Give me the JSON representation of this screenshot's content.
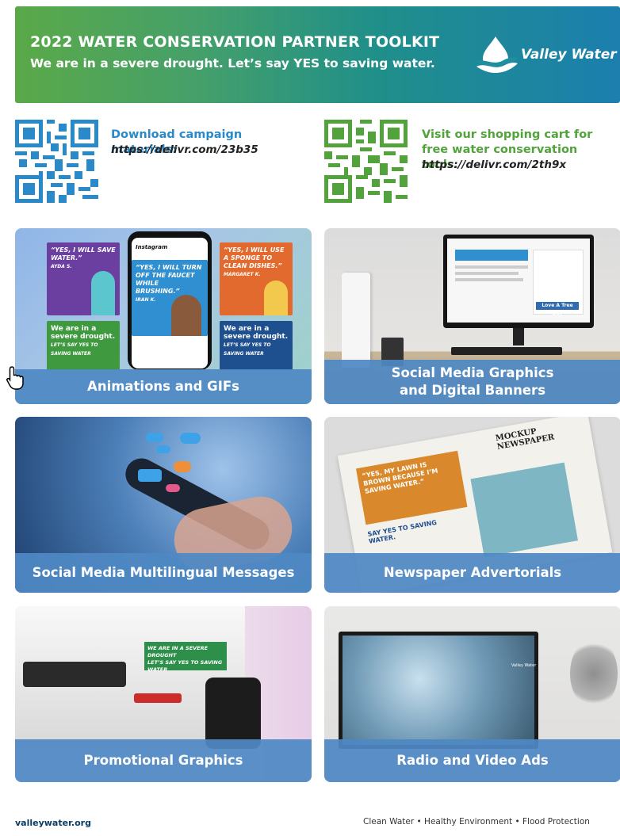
{
  "header": {
    "title": "2022 WATER CONSERVATION PARTNER TOOLKIT",
    "subtitle": "We are in a severe drought. Let’s say YES to saving water.",
    "logo_text": "Valley Water"
  },
  "qr_sections": [
    {
      "label": "Download campaign materials:",
      "url": "https://delivr.com/23b35",
      "color": "#2a89c8"
    },
    {
      "label": "Visit our shopping cart for free water conservation tools.",
      "url": "https://delivr.com/2th9x",
      "color": "#53a33c"
    }
  ],
  "cards": {
    "animations": {
      "caption": "Animations and GIFs",
      "poster1": "“YES, I WILL SAVE WATER.”",
      "poster1_name": "AYDA S.",
      "poster2": "“YES, I WILL TURN OFF THE FAUCET WHILE BRUSHING.”",
      "poster2_name": "IRAN K.",
      "poster3": "“YES, I WILL USE A SPONGE TO CLEAN DISHES.”",
      "poster3_name": "MARGARET K.",
      "poster4": "We are in a severe drought.",
      "poster4_cta": "LET’S SAY YES TO SAVING WATER",
      "poster5": "We are in a severe drought.",
      "poster5_cta": "LET’S SAY YES TO SAVING WATER",
      "phone_app": "Instagram"
    },
    "social_graphics": {
      "caption_line1": "Social Media Graphics",
      "caption_line2": "and Digital Banners",
      "screen_banner": "Love A Tree Day"
    },
    "multilingual": {
      "caption": "Social Media Multilingual Messages"
    },
    "newspaper": {
      "caption": "Newspaper Advertorials",
      "ad_headline": "“YES, MY LAWN IS BROWN BECAUSE I’M SAVING WATER.”",
      "ad_cta": "SAY YES TO SAVING WATER.",
      "paper_title": "MOCKUP NEWSPAPER"
    },
    "promotional": {
      "caption": "Promotional Graphics",
      "sticker_line1": "WE ARE IN A SEVERE DROUGHT",
      "sticker_line2": "LET’S SAY YES TO SAVING WATER"
    },
    "radio": {
      "caption": "Radio and Video Ads",
      "tv_logo": "Valley Water"
    }
  },
  "footer": {
    "site": "valleywater.org",
    "tagline": "Clean Water  •  Healthy Environment  •  Flood Protection"
  },
  "colors": {
    "caption_bar": "#4f89c4",
    "banner_start": "#5aa948",
    "banner_end": "#1c7fae",
    "qr_blue": "#2a89c8",
    "qr_green": "#53a33c"
  }
}
